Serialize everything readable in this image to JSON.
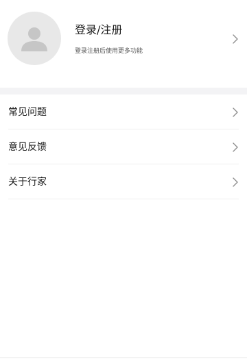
{
  "profile": {
    "title": "登录/注册",
    "subtitle": "登录注册后使用更多功能",
    "avatar_icon": "user-placeholder-icon",
    "chevron_icon": "chevron-right-icon"
  },
  "menu": {
    "items": [
      {
        "label": "常见问题",
        "icon": "chevron-right-icon"
      },
      {
        "label": "意见反馈",
        "icon": "chevron-right-icon"
      },
      {
        "label": "关于行家",
        "icon": "chevron-right-icon"
      }
    ]
  },
  "colors": {
    "background": "#ffffff",
    "section_divider": "#f3f3f5",
    "avatar_background": "#e8e8e8",
    "avatar_figure": "#c6c6c6",
    "chevron": "#8a8a8a",
    "text_primary": "#1a1a1a",
    "text_secondary": "#555555"
  }
}
